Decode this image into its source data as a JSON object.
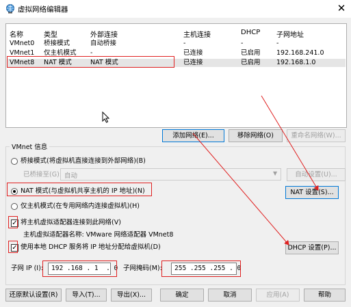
{
  "window": {
    "title": "虚拟网络编辑器",
    "close": "✕"
  },
  "table": {
    "columns": [
      "名称",
      "类型",
      "外部连接",
      "主机连接",
      "DHCP",
      "子网地址"
    ],
    "rows": [
      [
        "VMnet0",
        "桥接模式",
        "自动桥接",
        "-",
        "-",
        "-"
      ],
      [
        "VMnet1",
        "仅主机模式",
        "-",
        "已连接",
        "已启用",
        "192.168.241.0"
      ],
      [
        "VMnet8",
        "NAT 模式",
        "NAT 模式",
        "已连接",
        "已启用",
        "192.168.1.0"
      ]
    ],
    "selected_row": "VMnet8"
  },
  "network_buttons": {
    "add": "添加网络(E)...",
    "remove": "移除网络(O)",
    "rename": "重命名网络(W)..."
  },
  "vmnet_info": {
    "group_label": "VMnet 信息",
    "bridge_radio": "桥接模式(将虚拟机直接连接到外部网络)(B)",
    "bridge_to_label": "已桥接至(G):",
    "bridge_to_value": "自动",
    "auto_settings": "自动设置(U)...",
    "nat_radio": "NAT 模式(与虚拟机共享主机的 IP 地址)(N)",
    "nat_settings": "NAT 设置(S)...",
    "hostonly_radio": "仅主机模式(在专用网络内连接虚拟机)(H)",
    "connect_adapter": "将主机虚拟适配器连接到此网络(V)",
    "adapter_name_label": "主机虚拟适配器名称: VMware 网络适配器 VMnet8",
    "use_dhcp": "使用本地 DHCP 服务将 IP 地址分配给虚拟机(D)",
    "dhcp_settings": "DHCP 设置(P)...",
    "subnet_ip_label": "子网 IP (I):",
    "subnet_ip": "192 .168 . 1  . 0",
    "subnet_mask_label": "子网掩码(M):",
    "subnet_mask": "255 .255 .255 . 0",
    "selected_mode": "nat",
    "connect_adapter_checked": true,
    "use_dhcp_checked": true
  },
  "footer": {
    "restore": "还原默认设置(R)",
    "import": "导入(T)...",
    "export": "导出(X)...",
    "ok": "确定",
    "cancel": "取消",
    "apply": "应用(A)",
    "help": "帮助"
  },
  "colors": {
    "annotation": "#e02020",
    "focus": "#0078d7",
    "selection": "#e5e5e5"
  }
}
